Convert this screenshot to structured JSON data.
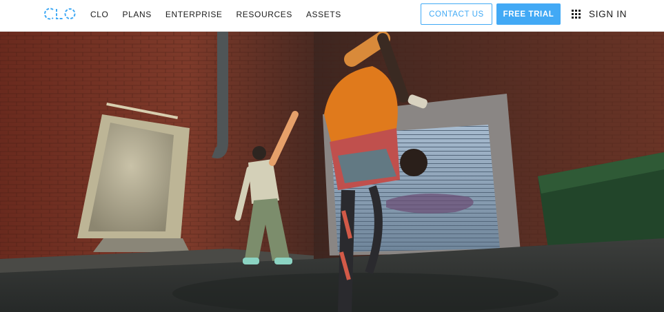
{
  "header": {
    "logo_text": "CLO",
    "nav": [
      {
        "label": "CLO"
      },
      {
        "label": "PLANS"
      },
      {
        "label": "ENTERPRISE"
      },
      {
        "label": "RESOURCES"
      },
      {
        "label": "ASSETS"
      }
    ],
    "contact_label": "CONTACT US",
    "trial_label": "FREE TRIAL",
    "apps_icon": "grid-icon",
    "signin_label": "SIGN IN"
  },
  "hero": {
    "image": "hero-image"
  },
  "colors": {
    "accent": "#42a9f5",
    "text": "#1a1a1a",
    "background": "#ffffff"
  }
}
